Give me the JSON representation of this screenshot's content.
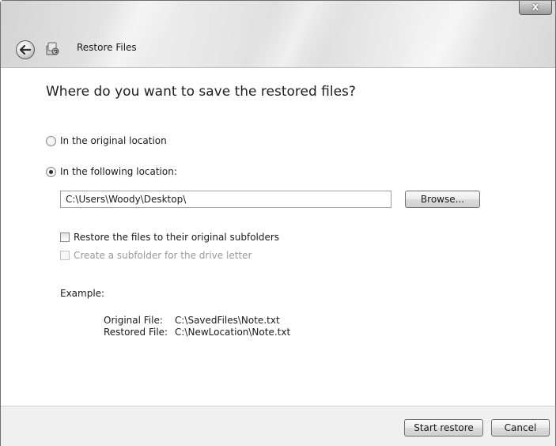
{
  "window": {
    "title": "Restore Files",
    "close_glyph": "X",
    "back_icon": "back-arrow-icon",
    "app_icon": "restore-files-icon"
  },
  "main": {
    "heading": "Where do you want to save the restored files?",
    "location_options": [
      {
        "label": "In the original location",
        "selected": false
      },
      {
        "label": "In the following location:",
        "selected": true
      }
    ],
    "path": {
      "value": "C:\\Users\\Woody\\Desktop\\"
    },
    "browse_label": "Browse...",
    "restore_subfolders": {
      "label": "Restore the files to their original subfolders",
      "checked": false,
      "enabled": true
    },
    "create_subfolder": {
      "label": "Create a subfolder for the drive letter",
      "checked": false,
      "enabled": false
    },
    "example": {
      "label": "Example:",
      "original_key": "Original File:",
      "original_value": "C:\\SavedFiles\\Note.txt",
      "restored_key": "Restored File:",
      "restored_value": "C:\\NewLocation\\Note.txt"
    }
  },
  "footer": {
    "start_label": "Start restore",
    "cancel_label": "Cancel"
  }
}
